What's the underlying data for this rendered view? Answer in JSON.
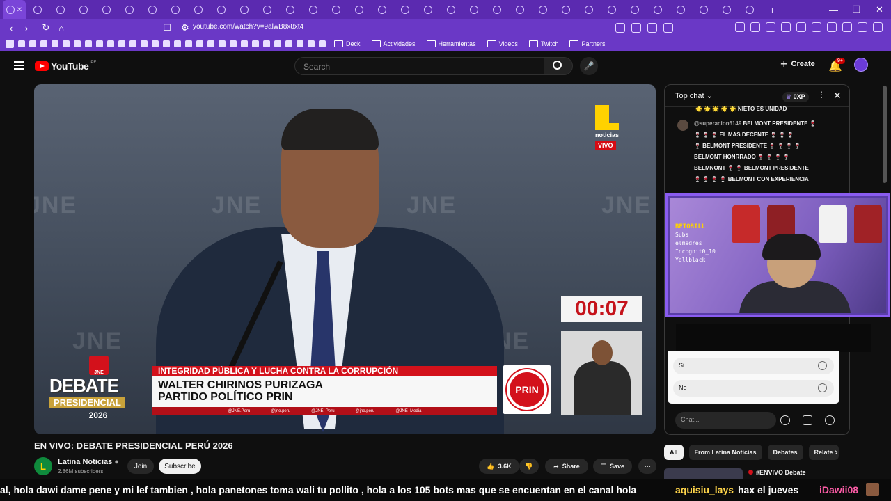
{
  "browser": {
    "url": "youtube.com/watch?v=9alwB8x8xt4",
    "bookmarks": [
      "Deck",
      "Actividades",
      "Herramientas",
      "Videos",
      "Twitch",
      "Partners"
    ]
  },
  "youtube": {
    "logo_text": "YouTube",
    "country": "PE",
    "search_placeholder": "Search",
    "create_label": "Create",
    "notif_count": "9+"
  },
  "video": {
    "title": "EN VIVO: DEBATE PRESIDENCIAL PERÚ 2026",
    "watermark": "JNE",
    "channel_logo_label": "noticias",
    "live_badge": "VIVO",
    "timer": "00:07",
    "band_topic": "INTEGRIDAD PÚBLICA Y LUCHA CONTRA LA CORRUPCIÓN",
    "candidate_name": "WALTER CHIRINOS PURIZAGA",
    "candidate_party": "PARTIDO POLÍTICO PRIN",
    "socials": [
      "@JNE.Peru",
      "@jne.peru",
      "@JNE_Peru",
      "@jne.peru",
      "@JNE_Media"
    ],
    "debate_badge": "JNE",
    "debate_line1": "DEBATE",
    "debate_line2": "PRESIDENCIAL",
    "debate_year": "2026",
    "party_logo": "PRIN"
  },
  "channel": {
    "name": "Latina Noticias",
    "subscribers": "2.86M subscribers",
    "join_label": "Join",
    "subscribe_label": "Subscribe",
    "likes": "3.6K",
    "share_label": "Share",
    "save_label": "Save"
  },
  "chat": {
    "mode": "Top chat",
    "points": "0XP",
    "messages": [
      {
        "user": "",
        "text": "🌟 🌟 🌟 🌟 🌟 NIETO ES UNIDAD"
      },
      {
        "user": "@superacion6149",
        "text": "BELMONT PRESIDENTE 🍷"
      },
      {
        "user": "",
        "text": "🍷 🍷 🍷 EL MAS DECENTE 🍷 🍷 🍷"
      },
      {
        "user": "",
        "text": "🍷 BELMONT PRESIDENTE 🍷 🍷 🍷 🍷"
      },
      {
        "user": "",
        "text": "BELMONT HONRRADO 🍷 🍷 🍷 🍷"
      },
      {
        "user": "",
        "text": "BELMNONT 🍷 🍷 BELMONT PRESIDENTE"
      },
      {
        "user": "",
        "text": "🍷 🍷 🍷 🍷 BELMONT CON EXPERIENCIA"
      }
    ],
    "poll_options": [
      "Si",
      "No"
    ],
    "input_placeholder": "Chat...",
    "overlay_header": "BETOBILL",
    "overlay_names": [
      "Subs",
      "elmadres",
      "Incognit0_10",
      "Yallblack"
    ]
  },
  "chips": [
    "All",
    "From Latina Noticias",
    "Debates",
    "Relate"
  ],
  "recommendation": {
    "title": "#ENVIVO Debate"
  },
  "ticker": {
    "text": "al, hola dawi dame pene y mi lef tambien , hola panetones toma wali tu pollito , hola a los 105 bots mas que se encuentan en el canal hola",
    "name1": "aquisiu_lays",
    "msg1": "hax el jueves",
    "name2": "iDawii08"
  }
}
